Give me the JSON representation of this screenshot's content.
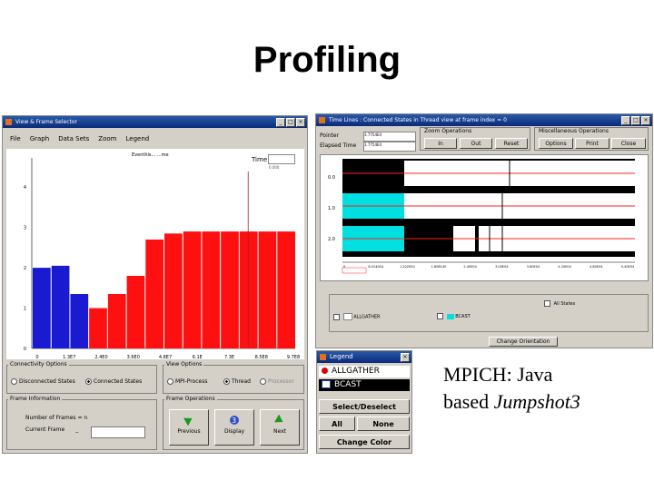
{
  "slide": {
    "title": "Profiling",
    "caption_line1": "MPICH: Java",
    "caption_line2_prefix": "based ",
    "caption_line2_italic": "Jumpshot3"
  },
  "histogram_window": {
    "title": "View & Frame Selector",
    "menu": [
      "File",
      "Graph",
      "Data Sets",
      "Zoom",
      "Legend"
    ],
    "plot_caption": "Eventhis... ...me",
    "time_label": "Time",
    "time_value": "0.000",
    "y_ticks": [
      "0",
      "1",
      "2",
      "3",
      "4"
    ],
    "x_ticks": [
      "0",
      "1.3E7",
      "2.4E0",
      "3.6E0",
      "4.8E7",
      "6.1E",
      "7.3E",
      "8.5E8",
      "9.7E8"
    ],
    "connectivity": {
      "label": "Connectivity Options",
      "options": [
        "Disconnected States",
        "Connected States"
      ],
      "selected": "Connected States"
    },
    "view": {
      "label": "View Options",
      "options": [
        "MPI-Process",
        "Thread",
        "Processor"
      ],
      "selected": "Thread"
    },
    "frame_info": {
      "label": "Frame Information",
      "num_frames_label": "Number of Frames",
      "num_frames_value": "= n",
      "current_frame_label": "Current Frame",
      "current_frame_value": "_"
    },
    "frame_ops": {
      "label": "Frame Operations",
      "buttons": [
        "Previous",
        "Display",
        "Next"
      ]
    }
  },
  "timeline_window": {
    "title": "Time Lines : Connected States in Thread view at frame index = 0",
    "pointer_label": "Pointer",
    "pointer_value": "3.7754E4",
    "elapsed_label": "Elapsed Time",
    "elapsed_value": "3.7754E4",
    "zoom_label": "Zoom Operations",
    "zoom_buttons": [
      "In",
      "Out",
      "Reset"
    ],
    "misc_label": "Miscellaneous Operations",
    "misc_buttons": [
      "Options",
      "Print",
      "Close"
    ],
    "row_labels": [
      "0.0",
      "1.0",
      "2.0"
    ],
    "axis_ticks": [
      "0",
      "6.014044",
      "1.202050",
      "1.808140",
      "2.40E04",
      "3.00E04",
      "3.60E04",
      "4.20E04",
      "4.80E04",
      "5.40E04"
    ],
    "legend_items": [
      "ALLGATHER",
      "BCAST"
    ],
    "all_states_label": "All States",
    "change_orientation": "Change Orientation"
  },
  "legend_window": {
    "title": "Legend",
    "items": [
      "ALLGATHER",
      "BCAST"
    ],
    "select_label": "Select/Deselect",
    "all_label": "All",
    "none_label": "None",
    "change_color_label": "Change Color"
  },
  "colors": {
    "allgather": "#ff0000",
    "bcast": "#00e0e0",
    "histogram_red": "#ff1010",
    "histogram_blue": "#1a1ad0",
    "title_bar": "#0a2a7a"
  },
  "chart_data": {
    "type": "bar",
    "title": "",
    "xlabel": "",
    "ylabel": "",
    "ylim": [
      0,
      4.5
    ],
    "categories": [
      "0",
      "1.3E7",
      "2.4E0",
      "3.6E0",
      "4.8E7",
      "6.1E",
      "7.3E",
      "8.5E8",
      "9.7E8"
    ],
    "series": [
      {
        "name": "BCAST",
        "values": [
          2.0,
          2.05,
          1.35,
          0,
          0,
          0,
          0,
          0,
          0,
          0,
          0,
          0,
          0,
          0
        ]
      },
      {
        "name": "ALLGATHER",
        "values": [
          0,
          0,
          0,
          1.0,
          1.35,
          1.8,
          2.7,
          2.85,
          2.9,
          2.9,
          2.9,
          2.9,
          2.9,
          2.9
        ]
      }
    ]
  }
}
